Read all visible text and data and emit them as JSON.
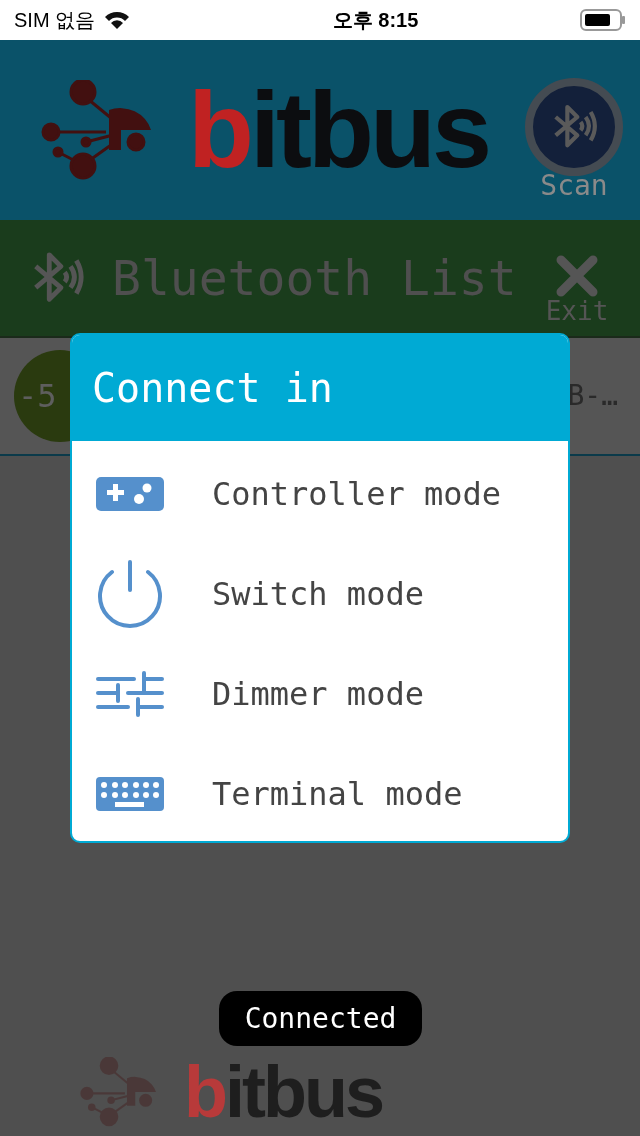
{
  "status_bar": {
    "carrier": "SIM 없음",
    "time": "오후 8:15"
  },
  "header": {
    "logo_accent": "b",
    "logo_rest": "itbus",
    "scan_label": "Scan"
  },
  "list_bar": {
    "title": "Bluetooth List",
    "exit_label": "Exit"
  },
  "devices": [
    {
      "rssi": "-5",
      "name": "B-…"
    }
  ],
  "dialog": {
    "title": "Connect in",
    "options": [
      {
        "kind": "controller",
        "label": "Controller mode"
      },
      {
        "kind": "switch",
        "label": "Switch mode"
      },
      {
        "kind": "dimmer",
        "label": "Dimmer mode"
      },
      {
        "kind": "terminal",
        "label": "Terminal mode"
      }
    ]
  },
  "toast": "Connected",
  "footer": {
    "logo_accent": "b",
    "logo_rest": "itbus"
  }
}
